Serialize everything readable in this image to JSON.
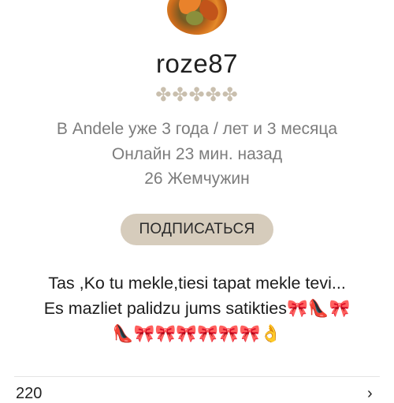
{
  "profile": {
    "username": "roze87",
    "rating_stars": "✤✤✤✤✤",
    "member_since": "В Andele уже 3 года / лет и 3 месяца",
    "online": "Онлайн 23 мин. назад",
    "pearls": "26 Жемчужин"
  },
  "actions": {
    "subscribe_label": "ПОДПИСАТЬСЯ"
  },
  "bio": {
    "text": "Tas ,Ko tu mekle,tiesi tapat mekle tevi...\nEs mazliet palidzu jums satikties🎀👠🎀\n👠🎀🎀🎀🎀🎀🎀👌"
  },
  "footer": {
    "left_text": "220",
    "right_text": "›"
  },
  "colors": {
    "accent_button": "#d6ccbc",
    "rating": "#c9bfae",
    "secondary_text": "#7c7c7c"
  }
}
